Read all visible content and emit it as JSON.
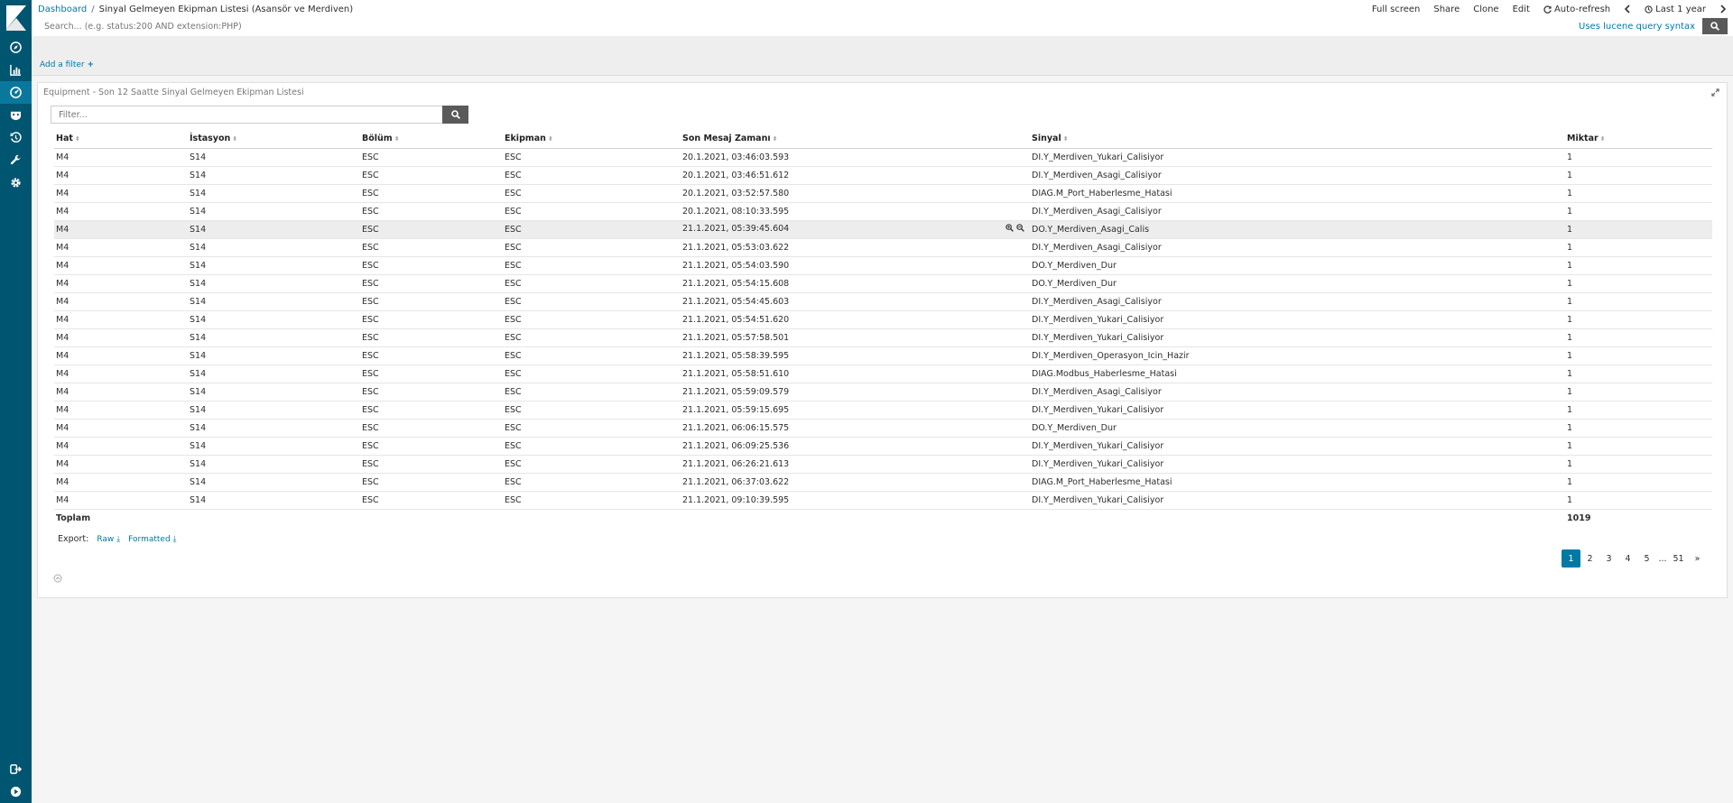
{
  "topbar": {
    "breadcrumb_root": "Dashboard",
    "breadcrumb_sep": "/",
    "page_title": "Sinyal Gelmeyen Ekipman Listesi (Asansör ve Merdiven)",
    "full_screen": "Full screen",
    "share": "Share",
    "clone": "Clone",
    "edit": "Edit",
    "auto_refresh": "Auto-refresh",
    "time_range": "Last 1 year"
  },
  "search": {
    "placeholder": "Search... (e.g. status:200 AND extension:PHP)",
    "lucene_link": "Uses lucene query syntax"
  },
  "filters": {
    "add_filter": "Add a filter"
  },
  "panel": {
    "title": "Equipment - Son 12 Saatte Sinyal Gelmeyen Ekipman Listesi",
    "filter_placeholder": "Filter...",
    "columns": [
      "Hat",
      "İstasyon",
      "Bölüm",
      "Ekipman",
      "Son Mesaj Zamanı",
      "Sinyal",
      "Miktar"
    ],
    "rows": [
      [
        "M4",
        "S14",
        "ESC",
        "ESC",
        "20.1.2021, 03:46:03.593",
        "DI.Y_Merdiven_Yukari_Calisiyor",
        "1"
      ],
      [
        "M4",
        "S14",
        "ESC",
        "ESC",
        "20.1.2021, 03:46:51.612",
        "DI.Y_Merdiven_Asagi_Calisiyor",
        "1"
      ],
      [
        "M4",
        "S14",
        "ESC",
        "ESC",
        "20.1.2021, 03:52:57.580",
        "DIAG.M_Port_Haberlesme_Hatasi",
        "1"
      ],
      [
        "M4",
        "S14",
        "ESC",
        "ESC",
        "20.1.2021, 08:10:33.595",
        "DI.Y_Merdiven_Asagi_Calisiyor",
        "1"
      ],
      [
        "M4",
        "S14",
        "ESC",
        "ESC",
        "21.1.2021, 05:39:45.604",
        "DO.Y_Merdiven_Asagi_Calis",
        "1"
      ],
      [
        "M4",
        "S14",
        "ESC",
        "ESC",
        "21.1.2021, 05:53:03.622",
        "DI.Y_Merdiven_Asagi_Calisiyor",
        "1"
      ],
      [
        "M4",
        "S14",
        "ESC",
        "ESC",
        "21.1.2021, 05:54:03.590",
        "DO.Y_Merdiven_Dur",
        "1"
      ],
      [
        "M4",
        "S14",
        "ESC",
        "ESC",
        "21.1.2021, 05:54:15.608",
        "DO.Y_Merdiven_Dur",
        "1"
      ],
      [
        "M4",
        "S14",
        "ESC",
        "ESC",
        "21.1.2021, 05:54:45.603",
        "DI.Y_Merdiven_Asagi_Calisiyor",
        "1"
      ],
      [
        "M4",
        "S14",
        "ESC",
        "ESC",
        "21.1.2021, 05:54:51.620",
        "DI.Y_Merdiven_Yukari_Calisiyor",
        "1"
      ],
      [
        "M4",
        "S14",
        "ESC",
        "ESC",
        "21.1.2021, 05:57:58.501",
        "DI.Y_Merdiven_Yukari_Calisiyor",
        "1"
      ],
      [
        "M4",
        "S14",
        "ESC",
        "ESC",
        "21.1.2021, 05:58:39.595",
        "DI.Y_Merdiven_Operasyon_Icin_Hazir",
        "1"
      ],
      [
        "M4",
        "S14",
        "ESC",
        "ESC",
        "21.1.2021, 05:58:51.610",
        "DIAG.Modbus_Haberlesme_Hatasi",
        "1"
      ],
      [
        "M4",
        "S14",
        "ESC",
        "ESC",
        "21.1.2021, 05:59:09.579",
        "DI.Y_Merdiven_Asagi_Calisiyor",
        "1"
      ],
      [
        "M4",
        "S14",
        "ESC",
        "ESC",
        "21.1.2021, 05:59:15.695",
        "DI.Y_Merdiven_Yukari_Calisiyor",
        "1"
      ],
      [
        "M4",
        "S14",
        "ESC",
        "ESC",
        "21.1.2021, 06:06:15.575",
        "DO.Y_Merdiven_Dur",
        "1"
      ],
      [
        "M4",
        "S14",
        "ESC",
        "ESC",
        "21.1.2021, 06:09:25.536",
        "DI.Y_Merdiven_Yukari_Calisiyor",
        "1"
      ],
      [
        "M4",
        "S14",
        "ESC",
        "ESC",
        "21.1.2021, 06:26:21.613",
        "DI.Y_Merdiven_Yukari_Calisiyor",
        "1"
      ],
      [
        "M4",
        "S14",
        "ESC",
        "ESC",
        "21.1.2021, 06:37:03.622",
        "DIAG.M_Port_Haberlesme_Hatasi",
        "1"
      ],
      [
        "M4",
        "S14",
        "ESC",
        "ESC",
        "21.1.2021, 09:10:39.595",
        "DI.Y_Merdiven_Yukari_Calisiyor",
        "1"
      ]
    ],
    "total_label": "Toplam",
    "total_value": "1019",
    "export_label": "Export:",
    "export_raw": "Raw",
    "export_formatted": "Formatted",
    "pages": [
      "1",
      "2",
      "3",
      "4",
      "5",
      "...",
      "51",
      "»"
    ]
  },
  "colors": {
    "sidebar": "#005571",
    "accent": "#0079a5"
  }
}
